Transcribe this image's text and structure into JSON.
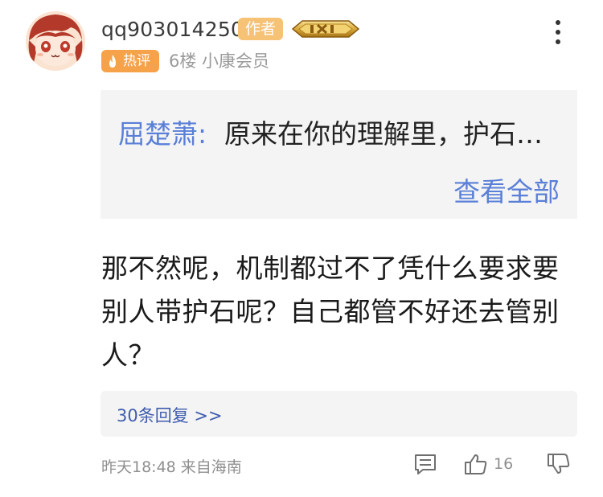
{
  "comment": {
    "username": "qq903014250",
    "author_badge": "作者",
    "hot_badge": "热评",
    "floor_and_level": "6楼 小康会员",
    "quote": {
      "author": "屈楚萧:",
      "text": "原来在你的理解里，护石…",
      "view_all": "查看全部"
    },
    "body": "那不然呢，机制都过不了凭什么要求要别人带护石呢？自己都管不好还去管别人？",
    "replies_link": "30条回复 >>",
    "timestamp": "昨天18:48 来自海南",
    "like_count": "16"
  },
  "icons": {
    "avatar": "anime-avatar",
    "level": "level-badge-icon",
    "more": "more-vertical-icon",
    "flame": "flame-icon",
    "reply": "reply-icon",
    "like": "thumbs-up-icon",
    "dislike": "thumbs-down-icon"
  },
  "colors": {
    "link_blue": "#5a7fd8",
    "author_badge": "#f6c275",
    "hot_badge": "#f6a24a",
    "muted_text": "#8f8f8f"
  }
}
